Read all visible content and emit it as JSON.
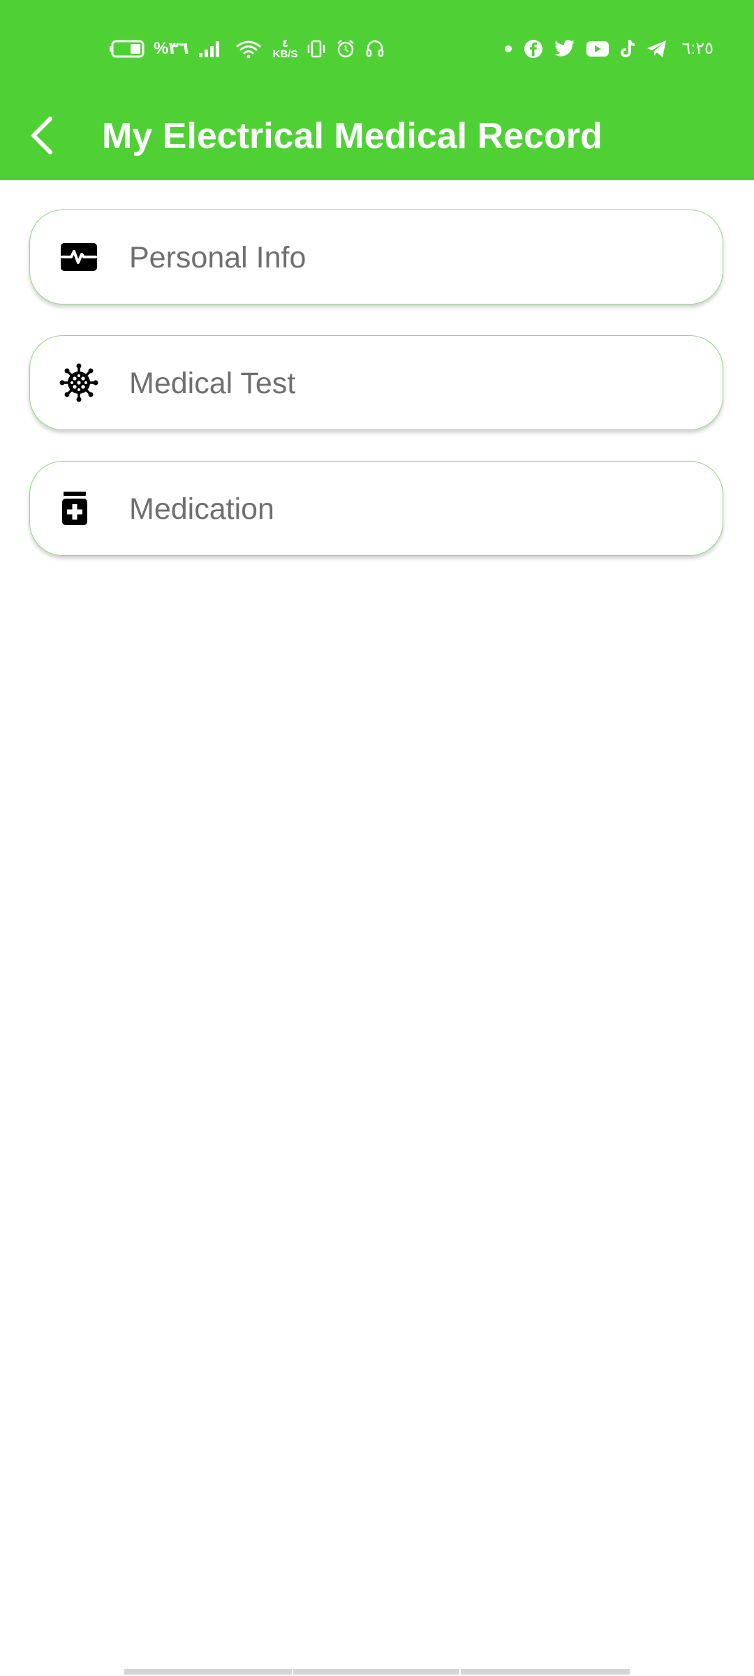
{
  "status_bar": {
    "battery_percent": "%٣٦",
    "network_speed_value": "٤",
    "network_speed_unit": "KB/S",
    "time": "٦:٢٥",
    "left_icons": [
      "battery-icon",
      "signal-icon",
      "wifi-icon",
      "vibrate-icon",
      "alarm-icon",
      "headset-icon"
    ],
    "right_icons": [
      "notification-dot-icon",
      "facebook-icon",
      "twitter-icon",
      "youtube-icon",
      "tiktok-icon",
      "telegram-icon"
    ]
  },
  "app_bar": {
    "title": "My Electrical Medical Record",
    "back_icon": "chevron-left-icon",
    "background_color": "#4fd136"
  },
  "menu": {
    "items": [
      {
        "label": "Personal Info",
        "icon": "health-card-icon"
      },
      {
        "label": "Medical Test",
        "icon": "virus-icon"
      },
      {
        "label": "Medication",
        "icon": "medicine-bottle-icon"
      }
    ],
    "border_color": "#8fd97f",
    "label_color": "#6f6f6f"
  }
}
